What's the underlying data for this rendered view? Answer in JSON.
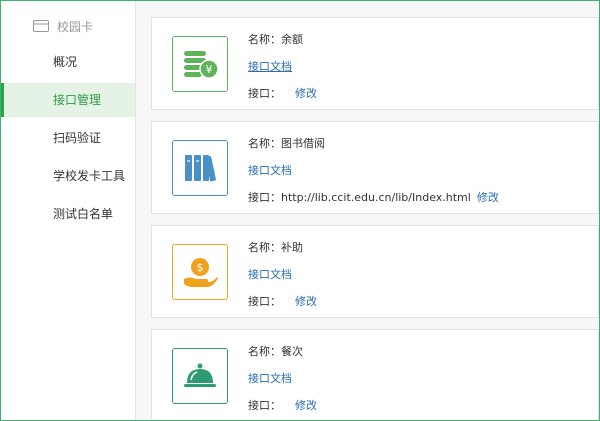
{
  "sidebar": {
    "header": "校园卡",
    "items": [
      {
        "label": "概况"
      },
      {
        "label": "接口管理",
        "active": true
      },
      {
        "label": "扫码验证"
      },
      {
        "label": "学校发卡工具"
      },
      {
        "label": "测试白名单"
      }
    ]
  },
  "cards": [
    {
      "icon": "coins-yuan-icon",
      "color": "#5fb35a",
      "name": "名称：余额",
      "doc": "接口文档",
      "iface_label": "接口：",
      "iface_url": "",
      "edit": "修改"
    },
    {
      "icon": "books-icon",
      "color": "#4a90c8",
      "name": "名称：图书借阅",
      "doc": "接口文档",
      "iface_label": "接口：",
      "iface_url": "http://lib.ccit.edu.cn/lib/Index.html",
      "edit": "修改"
    },
    {
      "icon": "hand-coin-icon",
      "color": "#f0a21e",
      "name": "名称：补助",
      "doc": "接口文档",
      "iface_label": "接口：",
      "iface_url": "",
      "edit": "修改"
    },
    {
      "icon": "cloche-icon",
      "color": "#2e9c72",
      "name": "名称：餐次",
      "doc": "接口文档",
      "iface_label": "接口：",
      "iface_url": "",
      "edit": "修改"
    }
  ]
}
